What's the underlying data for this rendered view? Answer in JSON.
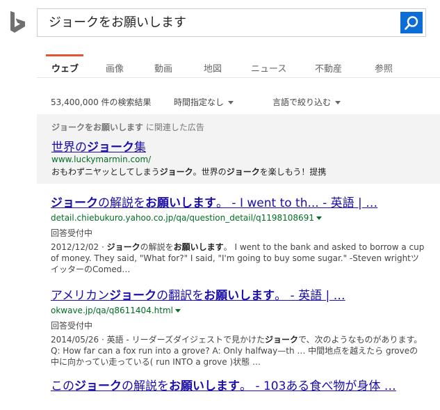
{
  "search": {
    "query": "ジョークをお願いします"
  },
  "tabs": [
    {
      "label": "ウェブ"
    },
    {
      "label": "画像"
    },
    {
      "label": "動画"
    },
    {
      "label": "地図"
    },
    {
      "label": "ニュース"
    },
    {
      "label": "不動産"
    },
    {
      "label": "参照"
    }
  ],
  "meta": {
    "result_count": "53,400,000 件の検索結果",
    "time_filter": "時間指定なし",
    "language_filter": "言語で絞り込む"
  },
  "ad": {
    "label_bold": "ジョークをお願いします",
    "label_rest": " に関連した広告",
    "title_pre": "世界の",
    "title_bold": "ジョーク",
    "title_post": "集",
    "url": "www.luckymarmin.com/",
    "desc_1": "おもわずニヤッとしてしまう",
    "desc_bold_1": "ジョーク",
    "desc_2": "。世界の",
    "desc_bold_2": "ジョーク",
    "desc_3": "を楽しもう！提携"
  },
  "results": [
    {
      "title_bold_1": "ジョーク",
      "title_1": "の解説を",
      "title_bold_2": "お願いします",
      "title_2": "。 - I went to th... - 英語 | …",
      "url": "detail.chiebukuro.yahoo.co.jp/qa/question_detail/q1198108691",
      "badge": "回答受付中",
      "snippet_1": "2012/12/02 · ",
      "snippet_bold_1": "ジョーク",
      "snippet_2": "の解説を",
      "snippet_bold_2": "お願いします",
      "snippet_3": "。 I went to the bank and asked to borrow a cup of money. They said, \"What for?\" I said, \"I'm going to buy some sugar.\" -Steven wrightツイッターのComed…"
    },
    {
      "title_1": "アメリカン",
      "title_bold_1": "ジョーク",
      "title_2": "の翻訳を",
      "title_bold_2": "お願いします",
      "title_3": "。 - 英語 | …",
      "url": "okwave.jp/qa/q8611404.html",
      "badge": "回答受付中",
      "snippet_1": "2014/05/26 · 英語 - リーダーズダイジェストで見かけた",
      "snippet_bold_1": "ジョーク",
      "snippet_2": "で、次のようなものがあります。 Q: How far can a fox run into a grove? A: Only halfway—th … 中間地点を越えたら groveの中に向かってい走っている( run INTO a grove )状態 …"
    },
    {
      "title_1": "この",
      "title_bold_1": "ジョーク",
      "title_2": "の解説を",
      "title_bold_2": "お願いします",
      "title_3": "。 - 103ある食べ物が身体 …"
    }
  ]
}
